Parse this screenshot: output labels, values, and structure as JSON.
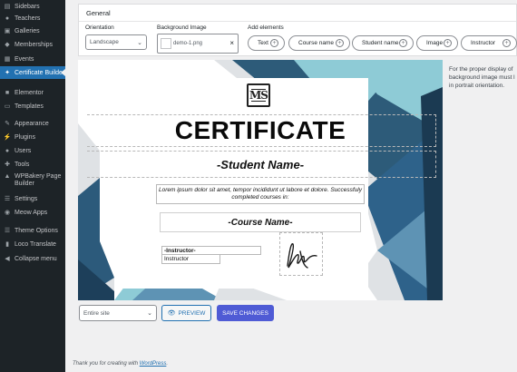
{
  "sidebar": {
    "items": [
      {
        "label": "Sidebars",
        "icon": "sidebars-icon",
        "glyph": "▤"
      },
      {
        "label": "Teachers",
        "icon": "teachers-icon",
        "glyph": "●"
      },
      {
        "label": "Galleries",
        "icon": "galleries-icon",
        "glyph": "▣"
      },
      {
        "label": "Memberships",
        "icon": "memberships-icon",
        "glyph": "◆"
      },
      {
        "label": "Events",
        "icon": "events-icon",
        "glyph": "▦"
      },
      {
        "label": "Certificate Builder",
        "icon": "certificate-icon",
        "glyph": "✦"
      },
      {
        "label": "Elementor",
        "icon": "elementor-icon",
        "glyph": "■"
      },
      {
        "label": "Templates",
        "icon": "templates-icon",
        "glyph": "▭"
      },
      {
        "label": "Appearance",
        "icon": "appearance-icon",
        "glyph": "✎"
      },
      {
        "label": "Plugins",
        "icon": "plugins-icon",
        "glyph": "⚡"
      },
      {
        "label": "Users",
        "icon": "users-icon",
        "glyph": "●"
      },
      {
        "label": "Tools",
        "icon": "tools-icon",
        "glyph": "✚"
      },
      {
        "label": "WPBakery Page Builder",
        "icon": "wpbakery-icon",
        "glyph": "▲"
      },
      {
        "label": "Settings",
        "icon": "settings-icon",
        "glyph": "☰"
      },
      {
        "label": "Meow Apps",
        "icon": "meow-icon",
        "glyph": "◉"
      },
      {
        "label": "Theme Options",
        "icon": "theme-options-icon",
        "glyph": "☰"
      },
      {
        "label": "Loco Translate",
        "icon": "loco-icon",
        "glyph": "▮"
      },
      {
        "label": "Collapse menu",
        "icon": "collapse-icon",
        "glyph": "◀"
      }
    ]
  },
  "general": {
    "title": "General",
    "orientation_label": "Orientation",
    "orientation_value": "Landscape",
    "bg_label": "Background Image",
    "bg_file": "demo-1.png",
    "add_label": "Add elements",
    "elements": [
      "Text",
      "Course name",
      "Student name",
      "Image",
      "Instructor"
    ]
  },
  "certificate": {
    "logo": "MS",
    "title": "CERTIFICATE",
    "student": "-Student Name-",
    "lorem": "Lorem ipsum dolor sit amet,  tempor incididunt ut labore et dolore. Successfuly completed courses in:",
    "course": "-Course Name-",
    "instructor_label": "-Instructor-",
    "instructor_name": "Instructor"
  },
  "note": {
    "line1": "For the proper display of",
    "line2": "background image must l",
    "line3": "in portrait orientation."
  },
  "bottom": {
    "scope": "Entire site",
    "preview": "PREVIEW",
    "save": "SAVE CHANGES"
  },
  "footer": {
    "prefix": "Thank you for creating with ",
    "link": "WordPress",
    "suffix": "."
  },
  "colors": {
    "accent": "#2271b1",
    "save_button": "#4f5bd5",
    "teal_light": "#8ccbd6",
    "blue_dark": "#2c5a7b",
    "navy": "#1e3a52"
  }
}
